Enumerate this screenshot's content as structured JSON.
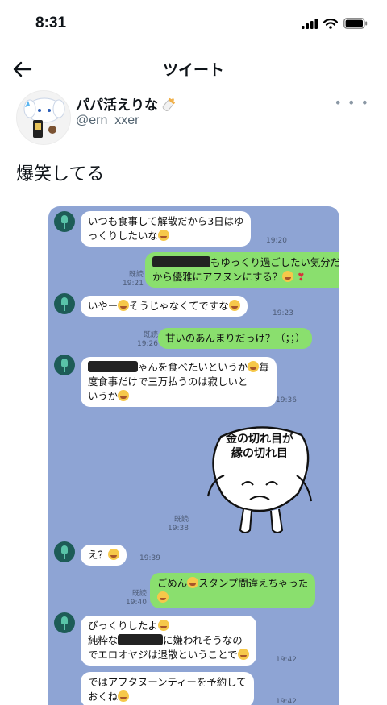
{
  "status_bar": {
    "time": "8:31"
  },
  "nav": {
    "title": "ツイート"
  },
  "author": {
    "name": "パパ活えりな",
    "handle": "@ern_xxer"
  },
  "tweet": {
    "text": "爆笑してる"
  },
  "chat": {
    "read_label": "既読",
    "messages": [
      {
        "line1": "いつも食事して解散だから3日はゆ",
        "line2": "っくりしたいな",
        "time": "19:20"
      },
      {
        "line1": "もゆっくり過ごしたい気分だ",
        "line2": "から優雅にアフヌンにする？",
        "time": "19:21"
      },
      {
        "text": "いやー",
        "text2": "そうじゃなくてですな",
        "time": "19:23"
      },
      {
        "text": "甘いのあんまりだっけ？（；；）",
        "time": "19:26"
      },
      {
        "line1": "ゃんを食べたいというか",
        "line1b": "毎",
        "line2": "度食事だけで三万払うのは寂しいと",
        "line3": "いうか",
        "time": "19:36"
      },
      {
        "time": "19:38"
      },
      {
        "text": "え？",
        "time": "19:39"
      },
      {
        "text": "ごめん",
        "text2": "スタンプ間違えちゃった",
        "time": "19:40"
      },
      {
        "line1": "びっくりしたよ",
        "line2a": "純粋な",
        "line2b": "に嫌われそうなの",
        "line3": "でエロオヤジは退散ということで",
        "time": "19:42"
      },
      {
        "line1": "ではアフタヌーンティーを予約して",
        "line2": "おくね",
        "time": "19:42"
      }
    ],
    "sticker": {
      "line1": "金の切れ目が",
      "line2": "縁の切れ目"
    }
  }
}
